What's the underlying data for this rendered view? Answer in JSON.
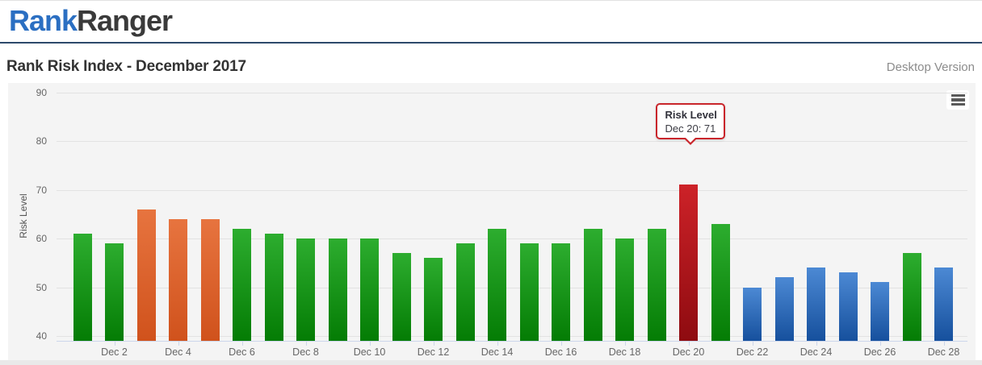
{
  "header": {
    "logo_part1": "Rank",
    "logo_part2": "Ranger"
  },
  "title_bar": {
    "title": "Rank Risk Index - December 2017",
    "version_label": "Desktop Version"
  },
  "export_menu": {
    "icon": "hamburger-icon"
  },
  "tooltip": {
    "title": "Risk Level",
    "text": "Dec 20: 71"
  },
  "chart_data": {
    "type": "bar",
    "title": "Rank Risk Index - December 2017",
    "xlabel": "",
    "ylabel": "Risk Level",
    "yticks": [
      40,
      50,
      60,
      70,
      80,
      90
    ],
    "ylim": [
      37,
      92
    ],
    "grid": "horizontal",
    "legend": "none",
    "categories": [
      "Dec 1",
      "Dec 2",
      "Dec 3",
      "Dec 4",
      "Dec 5",
      "Dec 6",
      "Dec 7",
      "Dec 8",
      "Dec 9",
      "Dec 10",
      "Dec 11",
      "Dec 12",
      "Dec 13",
      "Dec 14",
      "Dec 15",
      "Dec 16",
      "Dec 17",
      "Dec 18",
      "Dec 19",
      "Dec 20",
      "Dec 21",
      "Dec 22",
      "Dec 23",
      "Dec 24",
      "Dec 25",
      "Dec 26",
      "Dec 27",
      "Dec 28"
    ],
    "x_ticks_labeled": [
      "Dec 2",
      "Dec 4",
      "Dec 6",
      "Dec 8",
      "Dec 10",
      "Dec 12",
      "Dec 14",
      "Dec 16",
      "Dec 18",
      "Dec 20",
      "Dec 22",
      "Dec 24",
      "Dec 26",
      "Dec 28"
    ],
    "values": [
      61,
      59,
      66,
      64,
      64,
      62,
      61,
      60,
      60,
      60,
      57,
      56,
      59,
      62,
      59,
      59,
      62,
      60,
      62,
      71,
      63,
      50,
      52,
      54,
      53,
      51,
      57,
      54
    ],
    "point_colors": [
      "green",
      "green",
      "orange",
      "orange",
      "orange",
      "green",
      "green",
      "green",
      "green",
      "green",
      "green",
      "green",
      "green",
      "green",
      "green",
      "green",
      "green",
      "green",
      "green",
      "red",
      "green",
      "blue",
      "blue",
      "blue",
      "blue",
      "blue",
      "green",
      "blue"
    ],
    "tooltip_point_index": 19
  },
  "colors": {
    "logo_blue": "#2b6fc2",
    "logo_dark": "#3a3a3a",
    "header_border": "#2d4a6b",
    "plot_bg": "#f4f4f4",
    "grid_line": "#e2e2e2",
    "axis_line": "#ccd6eb",
    "label_gray": "#666666",
    "tooltip_border": "#c9252b",
    "bar_green_top": "#2dad2f",
    "bar_green_bottom": "#047c04",
    "bar_orange_top": "#e7743f",
    "bar_orange_bottom": "#d0521c",
    "bar_red_top": "#cd2228",
    "bar_red_bottom": "#8e0b10",
    "bar_blue_top": "#4c89d4",
    "bar_blue_bottom": "#16509d"
  }
}
